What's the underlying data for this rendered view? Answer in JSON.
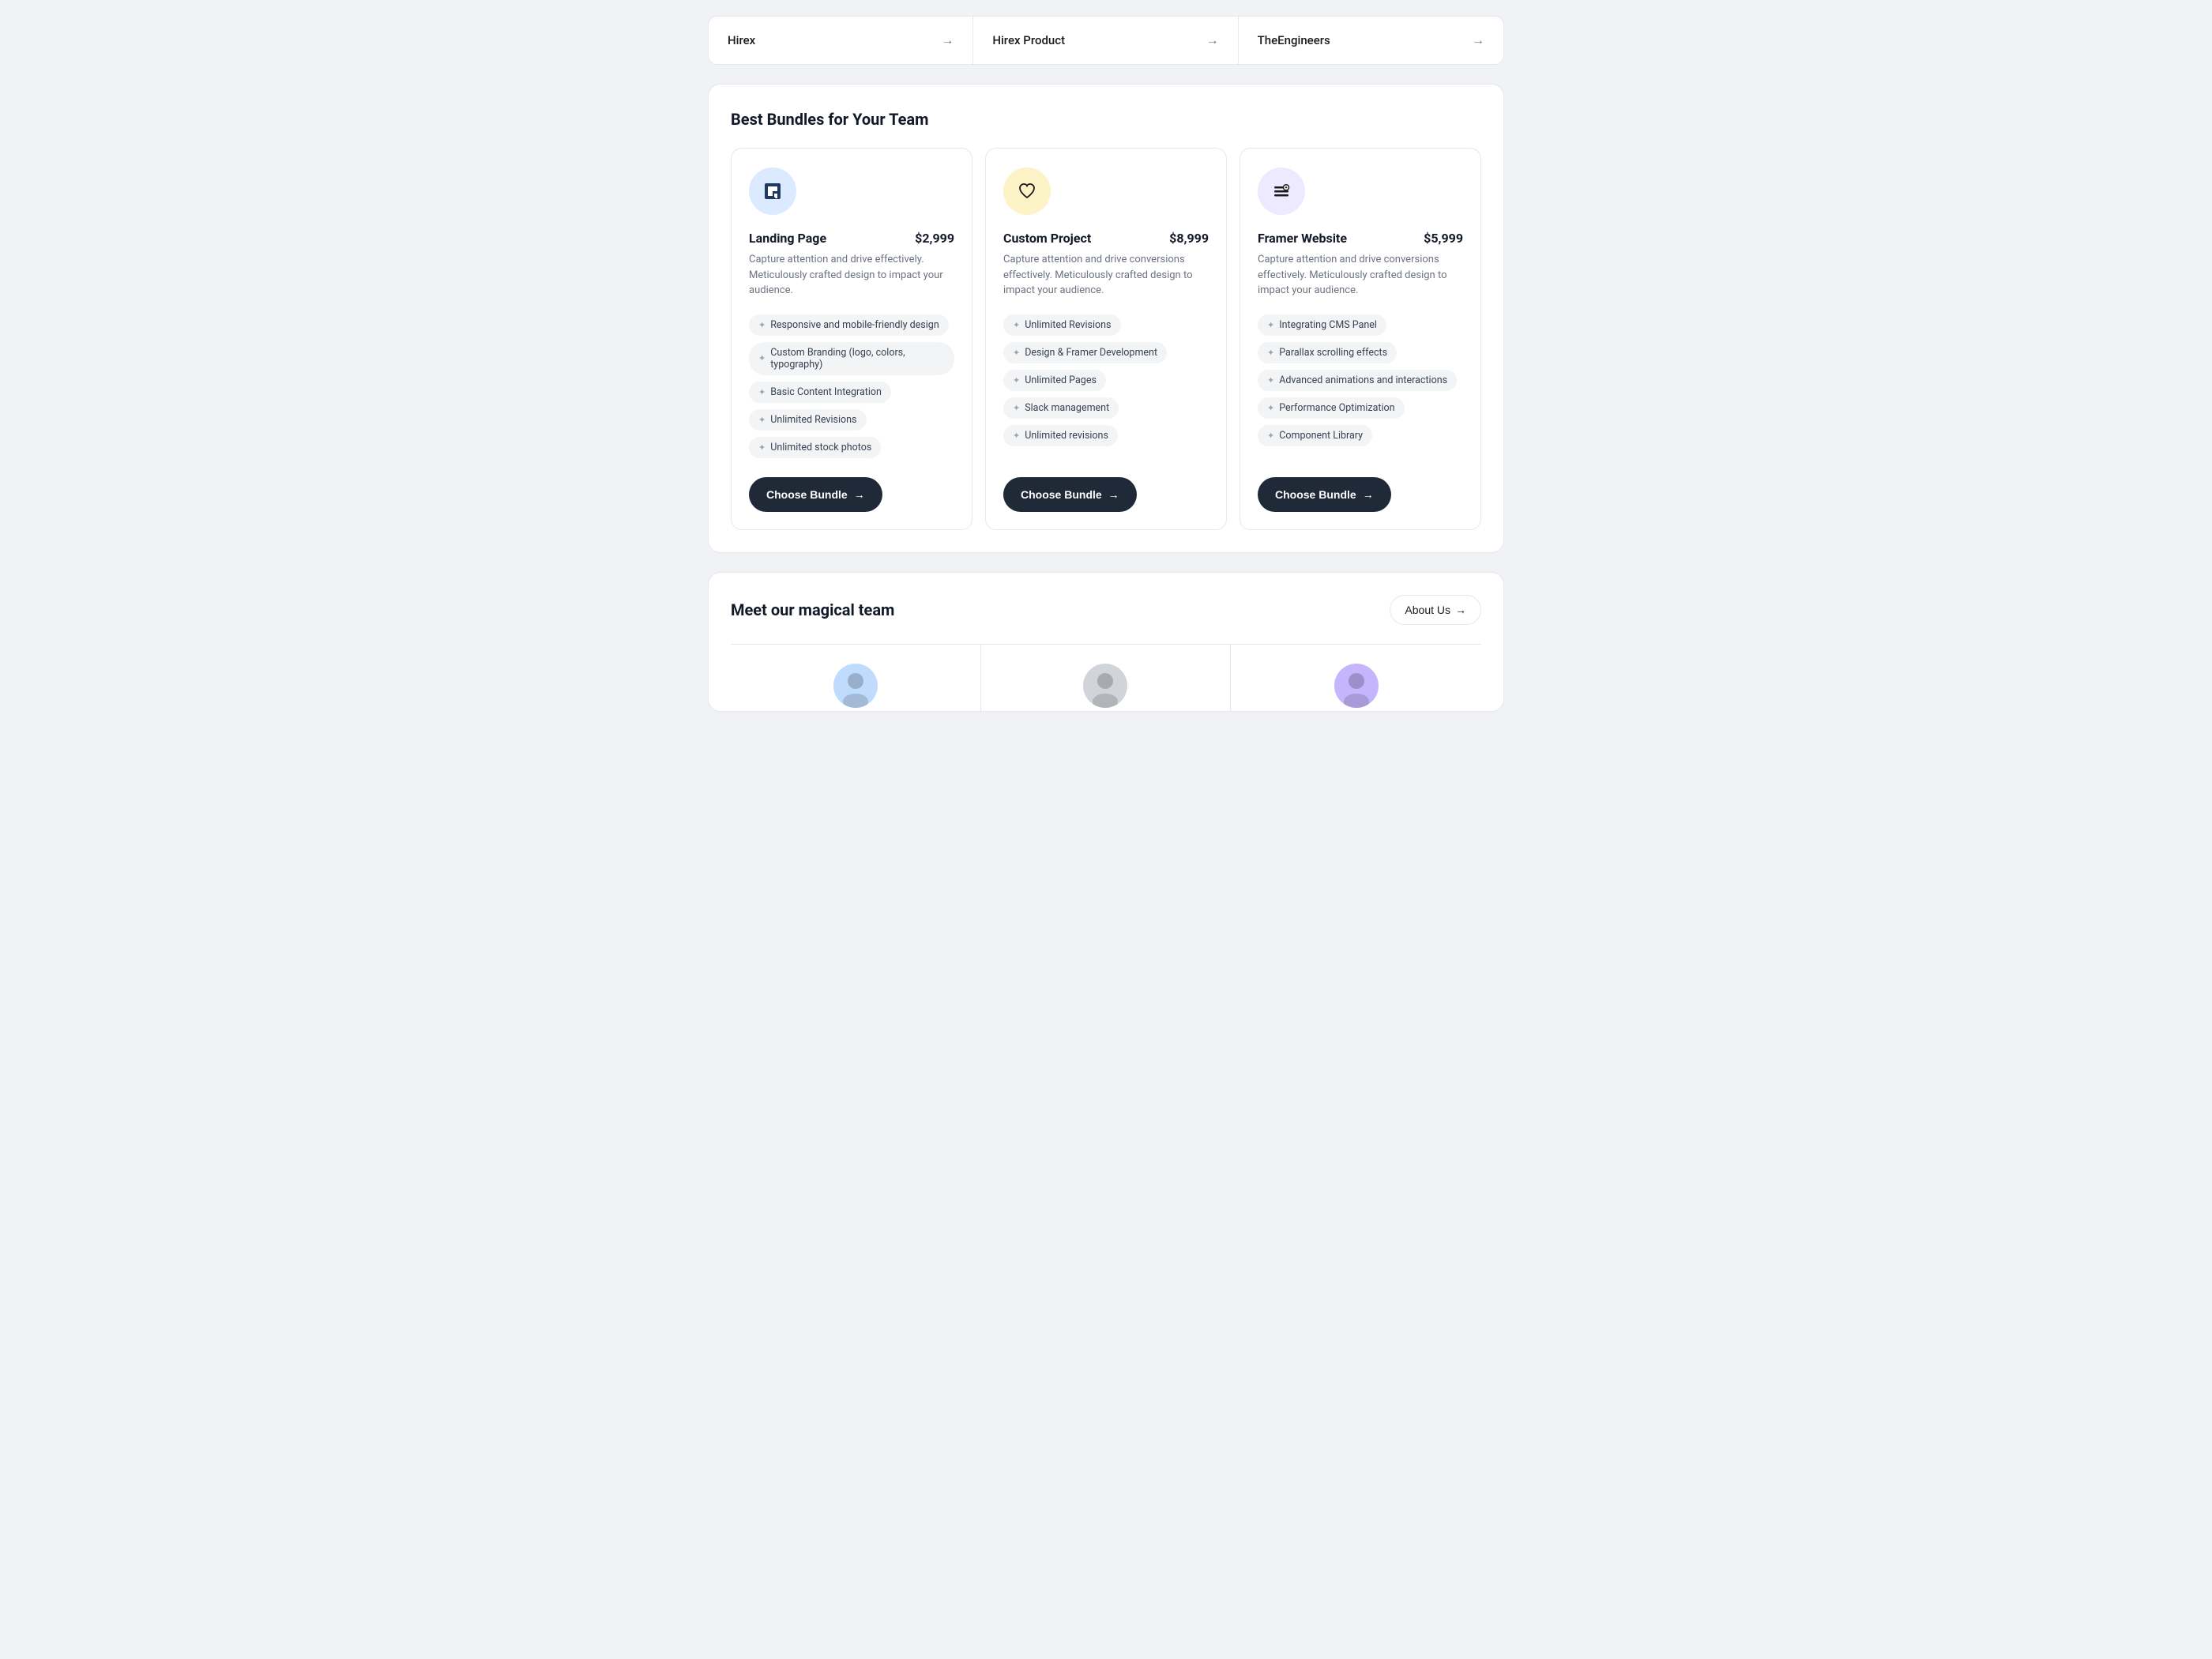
{
  "topLinks": [
    {
      "label": "Hirex",
      "id": "hirex"
    },
    {
      "label": "Hirex Product",
      "id": "hirex-product"
    },
    {
      "label": "TheEngineers",
      "id": "the-engineers"
    }
  ],
  "bundlesSection": {
    "title": "Best Bundles for Your Team",
    "bundles": [
      {
        "id": "landing-page",
        "name": "Landing Page",
        "price": "$2,999",
        "description": "Capture attention and drive  effectively. Meticulously crafted design to impact your audience.",
        "iconType": "blue",
        "iconSymbol": "🖱",
        "features": [
          "Responsive and mobile-friendly design",
          "Custom Branding (logo, colors, typography)",
          "Basic Content Integration",
          "Unlimited Revisions",
          "Unlimited stock photos"
        ],
        "btnLabel": "Choose Bundle"
      },
      {
        "id": "custom-project",
        "name": "Custom Project",
        "price": "$8,999",
        "description": "Capture attention and drive conversions effectively. Meticulously crafted design to impact your audience.",
        "iconType": "yellow",
        "iconSymbol": "♡",
        "features": [
          "Unlimited Revisions",
          "Design & Framer Development",
          "Unlimited Pages",
          "Slack management",
          "Unlimited revisions"
        ],
        "btnLabel": "Choose Bundle"
      },
      {
        "id": "framer-website",
        "name": "Framer Website",
        "price": "$5,999",
        "description": "Capture attention and drive conversions effectively. Meticulously crafted design to impact your audience.",
        "iconType": "purple",
        "iconSymbol": "≡",
        "features": [
          "Integrating CMS Panel",
          "Parallax scrolling effects",
          "Advanced animations and interactions",
          "Performance Optimization",
          "Component Library"
        ],
        "btnLabel": "Choose Bundle"
      }
    ]
  },
  "teamSection": {
    "title": "Meet our magical team",
    "aboutUsLabel": "About Us",
    "members": [
      {
        "id": "member-1",
        "avatarColor": "av1"
      },
      {
        "id": "member-2",
        "avatarColor": "av2"
      },
      {
        "id": "member-3",
        "avatarColor": "av3"
      }
    ]
  },
  "icons": {
    "arrow_right": "→",
    "sparkle": "✦",
    "btn_arrow": "→"
  }
}
